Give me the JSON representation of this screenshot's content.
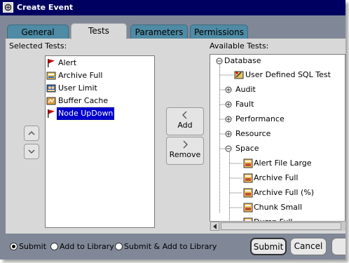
{
  "window": {
    "title": "Create Event"
  },
  "tabs": [
    {
      "label": "General",
      "active": false
    },
    {
      "label": "Tests",
      "active": true
    },
    {
      "label": "Parameters",
      "active": false
    },
    {
      "label": "Permissions",
      "active": false
    }
  ],
  "selected_tests": {
    "label": "Selected Tests:",
    "items": [
      {
        "label": "Alert",
        "icon": "flag-icon",
        "selected": false
      },
      {
        "label": "Archive Full",
        "icon": "database-icon",
        "selected": false
      },
      {
        "label": "User Limit",
        "icon": "users-icon",
        "selected": false
      },
      {
        "label": "Buffer Cache",
        "icon": "cache-icon",
        "selected": false
      },
      {
        "label": "Node UpDown",
        "icon": "flag-icon",
        "selected": true
      }
    ]
  },
  "transfer": {
    "add_label": "Add",
    "remove_label": "Remove"
  },
  "available_tests": {
    "label": "Available Tests:",
    "tree": [
      {
        "label": "Database",
        "depth": 0,
        "expander": "collapse"
      },
      {
        "label": "User Defined SQL Test",
        "depth": 1,
        "icon": "sql-test-icon"
      },
      {
        "label": "Audit",
        "depth": 1,
        "expander": "expand"
      },
      {
        "label": "Fault",
        "depth": 1,
        "expander": "expand"
      },
      {
        "label": "Performance",
        "depth": 1,
        "expander": "expand"
      },
      {
        "label": "Resource",
        "depth": 1,
        "expander": "expand"
      },
      {
        "label": "Space",
        "depth": 1,
        "expander": "collapse"
      },
      {
        "label": "Alert File Large",
        "depth": 2,
        "icon": "test-icon"
      },
      {
        "label": "Archive Full",
        "depth": 2,
        "icon": "test-icon"
      },
      {
        "label": "Archive Full (%)",
        "depth": 2,
        "icon": "test-icon"
      },
      {
        "label": "Chunk Small",
        "depth": 2,
        "icon": "test-icon"
      },
      {
        "label": "Dump Full",
        "depth": 2,
        "icon": "test-icon"
      }
    ]
  },
  "bottom": {
    "radios": [
      {
        "label": "Submit",
        "checked": true
      },
      {
        "label": "Add to Library",
        "checked": false
      },
      {
        "label": "Submit & Add to Library",
        "checked": false
      }
    ],
    "submit_label": "Submit",
    "cancel_label": "Cancel"
  },
  "colors": {
    "title_bar": "#000060",
    "tab_inactive": "#4f8ba4",
    "selection": "#0000cc",
    "panel": "#d8d8d8"
  }
}
